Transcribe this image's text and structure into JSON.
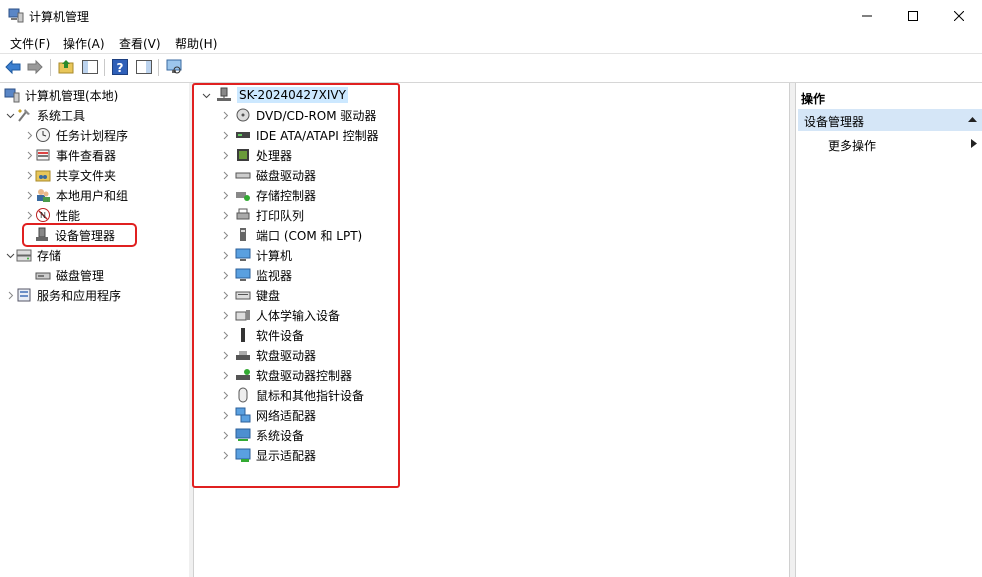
{
  "window": {
    "title": "计算机管理"
  },
  "menu": [
    "文件(F)",
    "操作(A)",
    "查看(V)",
    "帮助(H)"
  ],
  "tree": {
    "root": "计算机管理(本地)",
    "system_tools": "系统工具",
    "system_children": [
      "任务计划程序",
      "事件查看器",
      "共享文件夹",
      "本地用户和组",
      "性能",
      "设备管理器"
    ],
    "storage": "存储",
    "storage_children": [
      "磁盘管理"
    ],
    "services": "服务和应用程序"
  },
  "devices": {
    "computer_name": "SK-20240427XIVY",
    "items": [
      "DVD/CD-ROM 驱动器",
      "IDE ATA/ATAPI 控制器",
      "处理器",
      "磁盘驱动器",
      "存储控制器",
      "打印队列",
      "端口 (COM 和 LPT)",
      "计算机",
      "监视器",
      "键盘",
      "人体学输入设备",
      "软件设备",
      "软盘驱动器",
      "软盘驱动器控制器",
      "鼠标和其他指针设备",
      "网络适配器",
      "系统设备",
      "显示适配器"
    ]
  },
  "actions": {
    "header": "操作",
    "group": "设备管理器",
    "more": "更多操作"
  },
  "colors": {
    "highlight_border": "#e02020",
    "selection_bg": "#cce8ff",
    "action_group_bg": "#d5e6f7"
  }
}
